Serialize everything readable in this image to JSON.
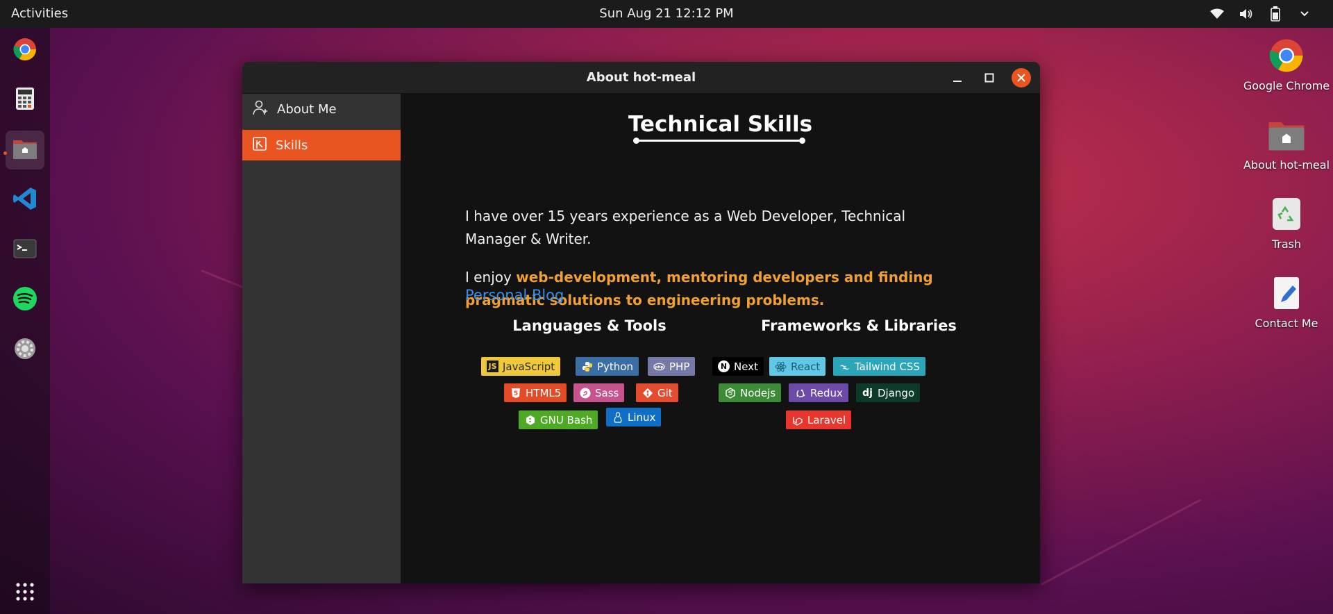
{
  "topbar": {
    "activities": "Activities",
    "clock": "Sun Aug 21 12:12 PM"
  },
  "dock": {
    "items": [
      "chrome-icon",
      "calculator-icon",
      "files-icon",
      "vscode-icon",
      "terminal-icon",
      "spotify-icon",
      "settings-icon"
    ],
    "apps_grid": "apps-grid-icon"
  },
  "desktop": {
    "icons": [
      {
        "label": "Google Chrome",
        "icon": "chrome-icon"
      },
      {
        "label": "About hot-meal",
        "icon": "home-folder-icon"
      },
      {
        "label": "Trash",
        "icon": "trash-icon"
      },
      {
        "label": "Contact Me",
        "icon": "text-editor-icon"
      }
    ]
  },
  "window": {
    "title": "About hot-meal",
    "sidebar": [
      {
        "label": "About Me",
        "icon": "user-add-icon",
        "selected": false
      },
      {
        "label": "Skills",
        "icon": "skills-icon",
        "selected": true
      }
    ],
    "content": {
      "heading": "Technical Skills",
      "intro": "I have over 15 years experience as a Web Developer, Technical Manager & Writer.",
      "enjoy_prefix": "I enjoy ",
      "enjoy_highlight": "web-development, mentoring developers and finding pragmatic solutions to engineering problems.",
      "blog_link": "Personal Blog",
      "languages_heading": "Languages & Tools",
      "frameworks_heading": "Frameworks & Libraries",
      "languages": [
        {
          "label": "JavaScript",
          "bg": "#f0c93a",
          "fg": "#2b2b2b",
          "icon": "JS"
        },
        {
          "label": "Python",
          "bg": "#3a6ea5",
          "fg": "#ffffff",
          "icon": "py"
        },
        {
          "label": "PHP",
          "bg": "#7479a8",
          "fg": "#ffffff",
          "icon": "php"
        },
        {
          "label": "HTML5",
          "bg": "#e34c26",
          "fg": "#ffffff",
          "icon": "5"
        },
        {
          "label": "Sass",
          "bg": "#c6538c",
          "fg": "#ffffff",
          "icon": "S"
        },
        {
          "label": "Git",
          "bg": "#e44c30",
          "fg": "#ffffff",
          "icon": "git"
        },
        {
          "label": "GNU Bash",
          "bg": "#4eaa25",
          "fg": "#ffffff",
          "icon": "$"
        },
        {
          "label": "Linux",
          "bg": "#0f6fc6",
          "fg": "#ffffff",
          "icon": "tux"
        }
      ],
      "frameworks": [
        {
          "label": "Next",
          "bg": "#000000",
          "fg": "#ffffff",
          "icon": "N"
        },
        {
          "label": "React",
          "bg": "#61c7e6",
          "fg": "#1d5f75",
          "icon": "re"
        },
        {
          "label": "Tailwind CSS",
          "bg": "#2ba5b8",
          "fg": "#ffffff",
          "icon": "tw"
        },
        {
          "label": "Nodejs",
          "bg": "#3d8b37",
          "fg": "#ffffff",
          "icon": "js"
        },
        {
          "label": "Redux",
          "bg": "#6c4aa8",
          "fg": "#ffffff",
          "icon": "rx"
        },
        {
          "label": "Django",
          "bg": "#0c3b2a",
          "fg": "#ffffff",
          "icon": "dj"
        },
        {
          "label": "Laravel",
          "bg": "#e7362d",
          "fg": "#ffffff",
          "icon": "lv"
        }
      ]
    }
  },
  "colors": {
    "accent": "#e95420",
    "highlight": "#f0a030",
    "link": "#3d8fe8"
  }
}
